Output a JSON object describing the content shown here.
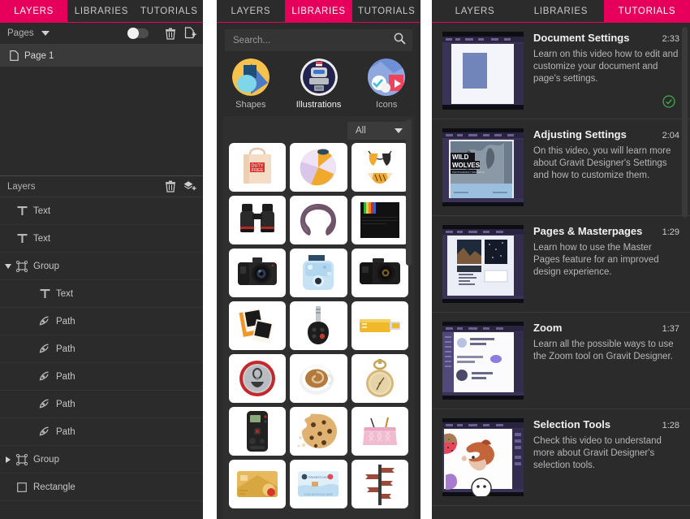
{
  "colors": {
    "accent": "#e6005c",
    "panel_bg": "#2b2b2b",
    "panel_bg_alt": "#2f2f2f",
    "row_selected": "#3a3a3a",
    "text": "#c9c9c9",
    "check_green": "#3fa84a"
  },
  "panels": {
    "left": {
      "tabs": [
        {
          "label": "LAYERS",
          "active": true
        },
        {
          "label": "LIBRARIES",
          "active": false
        },
        {
          "label": "TUTORIALS",
          "active": false
        }
      ],
      "pages_section": {
        "header_label": "Pages",
        "caret_icon": "chevron-down-icon",
        "toggle_icon": "toggle-switch",
        "toggle_on": false,
        "delete_icon": "trash-icon",
        "add_page_icon": "add-page-icon",
        "items": [
          {
            "label": "Page 1",
            "icon": "page-icon",
            "selected": true
          }
        ]
      },
      "layers_section": {
        "header_label": "Layers",
        "delete_icon": "trash-icon",
        "add_layer_icon": "add-layer-icon",
        "items": [
          {
            "label": "Text",
            "icon": "text-icon",
            "indent": 0,
            "disclosure": "none"
          },
          {
            "label": "Text",
            "icon": "text-icon",
            "indent": 0,
            "disclosure": "none"
          },
          {
            "label": "Group",
            "icon": "group-icon",
            "indent": 0,
            "disclosure": "open"
          },
          {
            "label": "Text",
            "icon": "text-icon",
            "indent": 1,
            "disclosure": "none"
          },
          {
            "label": "Path",
            "icon": "path-icon",
            "indent": 1,
            "disclosure": "none"
          },
          {
            "label": "Path",
            "icon": "path-icon",
            "indent": 1,
            "disclosure": "none"
          },
          {
            "label": "Path",
            "icon": "path-icon",
            "indent": 1,
            "disclosure": "none"
          },
          {
            "label": "Path",
            "icon": "path-icon",
            "indent": 1,
            "disclosure": "none"
          },
          {
            "label": "Path",
            "icon": "path-icon",
            "indent": 1,
            "disclosure": "none"
          },
          {
            "label": "Group",
            "icon": "group-icon",
            "indent": 0,
            "disclosure": "closed"
          },
          {
            "label": "Rectangle",
            "icon": "rectangle-icon",
            "indent": 0,
            "disclosure": "none"
          }
        ]
      }
    },
    "middle": {
      "tabs": [
        {
          "label": "LAYERS",
          "active": false
        },
        {
          "label": "LIBRARIES",
          "active": true
        },
        {
          "label": "TUTORIALS",
          "active": false
        }
      ],
      "search": {
        "placeholder": "Search...",
        "value": "",
        "icon": "search-icon"
      },
      "categories": [
        {
          "label": "Shapes",
          "icon": "shapes-thumbnail",
          "active": false
        },
        {
          "label": "Illustrations",
          "icon": "illustrations-robot-thumbnail",
          "active": true
        },
        {
          "label": "Icons",
          "icon": "icons-thumbnail",
          "active": false
        }
      ],
      "filter": {
        "value": "All",
        "caret_icon": "chevron-down-icon"
      },
      "items": [
        {
          "name": "duty-free-shopping-bag"
        },
        {
          "name": "beach-ball"
        },
        {
          "name": "bikini-swimsuit"
        },
        {
          "name": "binoculars"
        },
        {
          "name": "neck-pillow"
        },
        {
          "name": "instant-photo-film-pack"
        },
        {
          "name": "dslr-camera-front"
        },
        {
          "name": "instant-camera-blue"
        },
        {
          "name": "dslr-camera-side"
        },
        {
          "name": "instant-photos-pack"
        },
        {
          "name": "car-key-fob"
        },
        {
          "name": "usb-flash-drive-yellow"
        },
        {
          "name": "soda-can-top"
        },
        {
          "name": "coffee-cup-top"
        },
        {
          "name": "pocket-watch"
        },
        {
          "name": "tv-remote-control"
        },
        {
          "name": "chocolate-chip-cookie"
        },
        {
          "name": "pink-cosmetic-pouch"
        },
        {
          "name": "gold-credit-card"
        },
        {
          "name": "blue-credit-card"
        },
        {
          "name": "directions-signpost"
        }
      ]
    },
    "right": {
      "tabs": [
        {
          "label": "LAYERS",
          "active": false
        },
        {
          "label": "LIBRARIES",
          "active": false
        },
        {
          "label": "TUTORIALS",
          "active": true
        }
      ],
      "tutorials": [
        {
          "title": "Document Settings",
          "duration": "2:33",
          "description": "Learn on this video how to edit and customize your document and page's settings.",
          "watched": true,
          "thumb": "document-settings-thumbnail"
        },
        {
          "title": "Adjusting Settings",
          "duration": "2:04",
          "description": "On this video, you will learn more about Gravit Designer's Settings and how to customize them.",
          "watched": false,
          "thumb": "wild-wolves-thumbnail",
          "thumb_text": [
            "WILD",
            "WOLVES"
          ]
        },
        {
          "title": "Pages & Masterpages",
          "duration": "1:29",
          "description": "Learn how to use the Master Pages feature for an improved design experience.",
          "watched": false,
          "thumb": "pages-masterpages-thumbnail"
        },
        {
          "title": "Zoom",
          "duration": "1:37",
          "description": "Learn all the possible ways to use the Zoom tool on Gravit Designer.",
          "watched": false,
          "thumb": "zoom-thumbnail"
        },
        {
          "title": "Selection Tools",
          "duration": "1:28",
          "description": "Check this video to understand more about Gravit Designer's selection tools.",
          "watched": false,
          "thumb": "selection-tools-fox-thumbnail"
        }
      ]
    }
  }
}
